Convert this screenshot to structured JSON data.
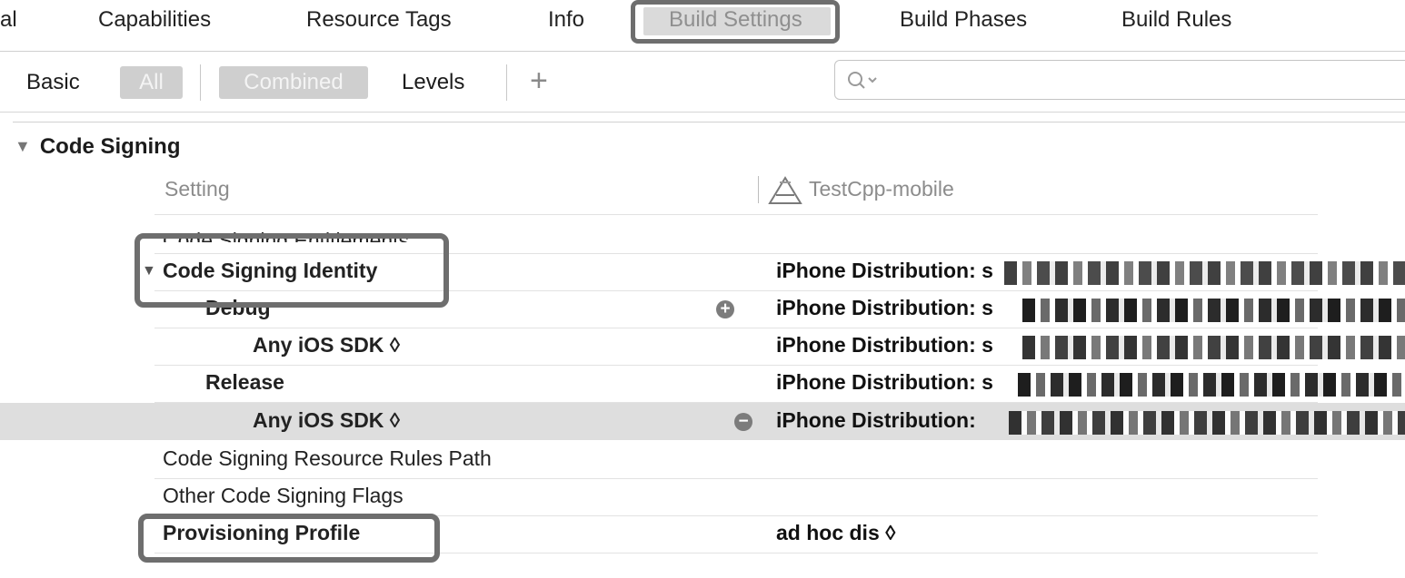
{
  "tabs": [
    {
      "label": "al"
    },
    {
      "label": "Capabilities"
    },
    {
      "label": "Resource Tags"
    },
    {
      "label": "Info"
    },
    {
      "label": "Build Settings",
      "active": true
    },
    {
      "label": "Build Phases"
    },
    {
      "label": "Build Rules"
    }
  ],
  "filter": {
    "basic": "Basic",
    "all": "All",
    "combined": "Combined",
    "levels": "Levels",
    "add": "+",
    "search_placeholder": ""
  },
  "section": {
    "title": "Code Signing",
    "col_setting": "Setting",
    "col_target": "TestCpp-mobile"
  },
  "rows": [
    {
      "label": "Code Signing Entitlements",
      "value": ""
    },
    {
      "label": "Code Signing Identity",
      "value": "iPhone Distribution: s"
    },
    {
      "label": "Debug",
      "value": "iPhone Distribution: s"
    },
    {
      "label": "Any iOS SDK ◊",
      "value": "iPhone Distribution: s"
    },
    {
      "label": "Release",
      "value": "iPhone Distribution: s"
    },
    {
      "label": "Any iOS SDK ◊",
      "value": "iPhone Distribution:"
    },
    {
      "label": "Code Signing Resource Rules Path",
      "value": ""
    },
    {
      "label": "Other Code Signing Flags",
      "value": ""
    },
    {
      "label": "Provisioning Profile",
      "value": "ad hoc dis ◊"
    }
  ],
  "colors": {
    "highlight": "#6e6e6e",
    "selected_row": "#dedede",
    "chip": "#cfcfcf"
  }
}
